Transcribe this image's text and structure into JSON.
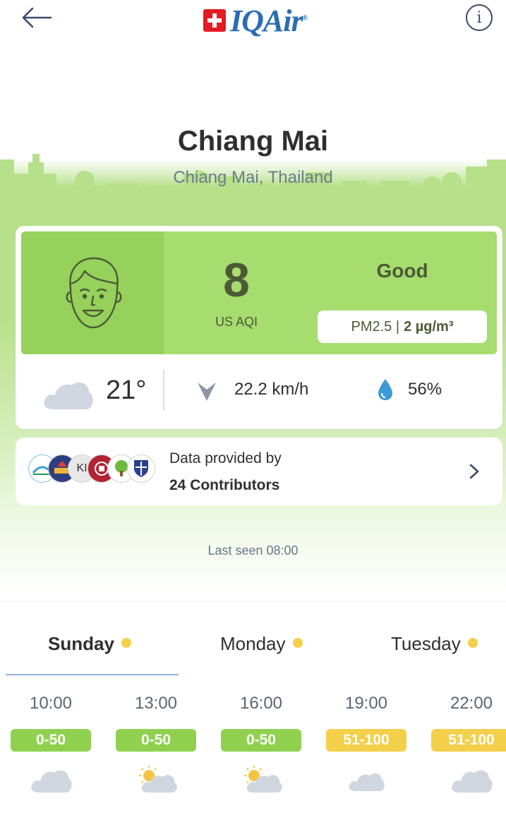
{
  "header": {
    "brand": "IQAir",
    "brand_mark": "®",
    "back_icon": "arrow-left-icon",
    "info_icon": "info-icon",
    "info_glyph": "i"
  },
  "location": {
    "city": "Chiang Mai",
    "region": "Chiang Mai, Thailand"
  },
  "aqi": {
    "value": "8",
    "label": "US AQI",
    "status": "Good",
    "pollutant": "PM2.5 |",
    "concentration": "2 µg/m³",
    "face_icon": "happy-face-icon"
  },
  "weather": {
    "temperature": "21°",
    "wind": "22.2 km/h",
    "humidity": "56%",
    "condition_icon": "cloud-icon",
    "wind_icon": "wind-direction-icon",
    "humidity_icon": "water-drop-icon"
  },
  "contributors": {
    "line1": "Data provided by",
    "line2": "24 Contributors",
    "logo_text": "KI"
  },
  "last_seen": "Last seen 08:00",
  "forecast": {
    "days": [
      {
        "label": "Sunday",
        "active": true
      },
      {
        "label": "Monday",
        "active": false
      },
      {
        "label": "Tuesday",
        "active": false
      }
    ],
    "slots": [
      {
        "time": "10:00",
        "range": "0-50",
        "icon": "cloud-icon"
      },
      {
        "time": "13:00",
        "range": "0-50",
        "icon": "sun-cloud-icon"
      },
      {
        "time": "16:00",
        "range": "0-50",
        "icon": "sun-cloud-icon"
      },
      {
        "time": "19:00",
        "range": "51-100",
        "icon": "cloud-icon"
      },
      {
        "time": "22:00",
        "range": "51-100",
        "icon": "cloud-icon"
      }
    ]
  },
  "colors": {
    "good": "#a7dc6f",
    "good_dark": "#95d15b",
    "good_pill": "#8fd14f",
    "moderate_pill": "#f4cf4a",
    "brand_red": "#e31b23",
    "brand_blue": "#2a6db5"
  }
}
